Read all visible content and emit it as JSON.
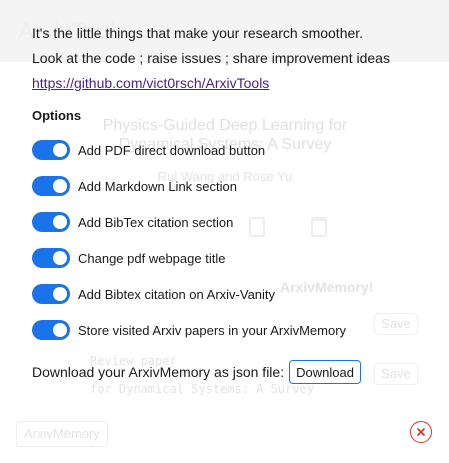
{
  "background": {
    "app_title": "ArxivTools",
    "paper_title": "Physics-Guided Deep Learning for Dynamical Systems: A Survey",
    "authors": "Rui Wang and Rose Yu",
    "memory_heading": "ArxivMemory!",
    "save_label": "Save",
    "memory_note_1": "Review paper",
    "memory_note_2": "for Dynamical Systems: A Survey",
    "memory_tag": "ArxivMemory"
  },
  "intro": {
    "line1": "It's the little things that make your research smoother.",
    "line2": "Look at the code ; raise issues ; share improvement ideas",
    "link": "https://github.com/vict0rsch/ArxivTools"
  },
  "options": {
    "heading": "Options",
    "items": [
      {
        "label": "Add PDF direct download button",
        "enabled": true
      },
      {
        "label": "Add Markdown Link section",
        "enabled": true
      },
      {
        "label": "Add BibTex citation section",
        "enabled": true
      },
      {
        "label": "Change pdf webpage title",
        "enabled": true
      },
      {
        "label": "Add Bibtex citation on Arxiv-Vanity",
        "enabled": true
      },
      {
        "label": "Store visited Arxiv papers in your ArxivMemory",
        "enabled": true
      }
    ]
  },
  "download": {
    "text": "Download your ArxivMemory as json file:",
    "button_label": "Download"
  },
  "colors": {
    "toggle_on": "#1a73e8",
    "link": "#4b1f84",
    "close": "#d93025"
  },
  "icons": {
    "close": "close-icon"
  }
}
